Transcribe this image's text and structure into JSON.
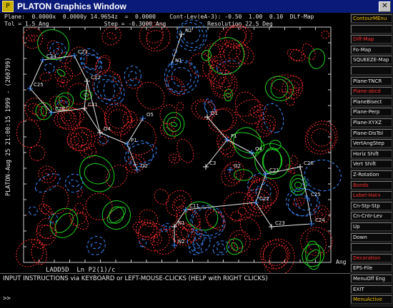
{
  "window": {
    "title": "PLATON Graphics Window",
    "close_glyph": "✕",
    "app_icon": "P"
  },
  "header": {
    "line1": "Plane:  0.0000x  0.0000y 14.9654z  =  0.0000    Cont-Lev(eA-3): -0.50  1.00  0.10  DLf-Map",
    "line2": "Tol = 1.5 Ang                Step = -0.3000 Ang            Resolution 22.5 Deg"
  },
  "side_text": "PLATON-Aug 25 21:00:15 1999 - (260799)",
  "bottom_title": "LADD5D  Ln P2(1)/c",
  "ang_label": "Ang",
  "instructions": {
    "line": "INPUT INSTRUCTIONS via KEYBOARD or LEFT-MOUSE-CLICKS (HELP with RIGHT CLICKS)",
    "prompt": ">>"
  },
  "atom_labels": [
    "N2",
    "C24",
    "C23",
    "C22",
    "C25",
    "C28",
    "C21",
    "N1",
    "O5",
    "O4",
    "P1",
    "O2",
    "O1",
    "O2",
    "P1",
    "C3",
    "O4",
    "C21",
    "C26",
    "C22",
    "C25",
    "C23",
    "C24",
    "C11",
    "N1",
    "N2"
  ],
  "menu": [
    {
      "label": "ContourMEnu",
      "style": "gold"
    },
    {
      "label": "",
      "style": "plain"
    },
    {
      "label": "Diff-Map",
      "style": "red"
    },
    {
      "label": "Fo-Map",
      "style": "plain"
    },
    {
      "label": "SQUEEZE-Map",
      "style": "plain"
    },
    {
      "label": "",
      "style": "plain"
    },
    {
      "label": "Plane-TNCR",
      "style": "plain"
    },
    {
      "label": "Plane-abcd",
      "style": "red"
    },
    {
      "label": "PlaneBisect",
      "style": "plain"
    },
    {
      "label": "Plane-Perp",
      "style": "plain"
    },
    {
      "label": "Plane-XYXZ",
      "style": "plain"
    },
    {
      "label": "Plane-DisTol",
      "style": "plain"
    },
    {
      "label": "VertAngStep",
      "style": "plain"
    },
    {
      "label": "Horiz Shift",
      "style": "plain"
    },
    {
      "label": "Vert Shift",
      "style": "plain"
    },
    {
      "label": "Z-Rotation",
      "style": "plain"
    },
    {
      "label": "Bonds",
      "style": "red"
    },
    {
      "label": "Label-Hat+",
      "style": "red"
    },
    {
      "label": "Cn-Stp-Stp",
      "style": "plain"
    },
    {
      "label": "Cn-Cntr-Lev",
      "style": "plain"
    },
    {
      "label": "Up",
      "style": "plain"
    },
    {
      "label": "Down",
      "style": "plain"
    },
    {
      "label": "",
      "style": "plain"
    },
    {
      "label": "Decoration",
      "style": "red"
    },
    {
      "label": "EPS-File",
      "style": "plain"
    },
    {
      "label": "MenuOff Eng",
      "style": "plain"
    },
    {
      "label": "EXIT",
      "style": "plain"
    },
    {
      "label": "MenuActive",
      "style": "gold"
    }
  ],
  "colors": {
    "positive": "#22d422",
    "negative": "#ff3030",
    "zero": "#3a8cff",
    "bonds": "#e8e8e8",
    "atoms": "#3a8cff"
  }
}
